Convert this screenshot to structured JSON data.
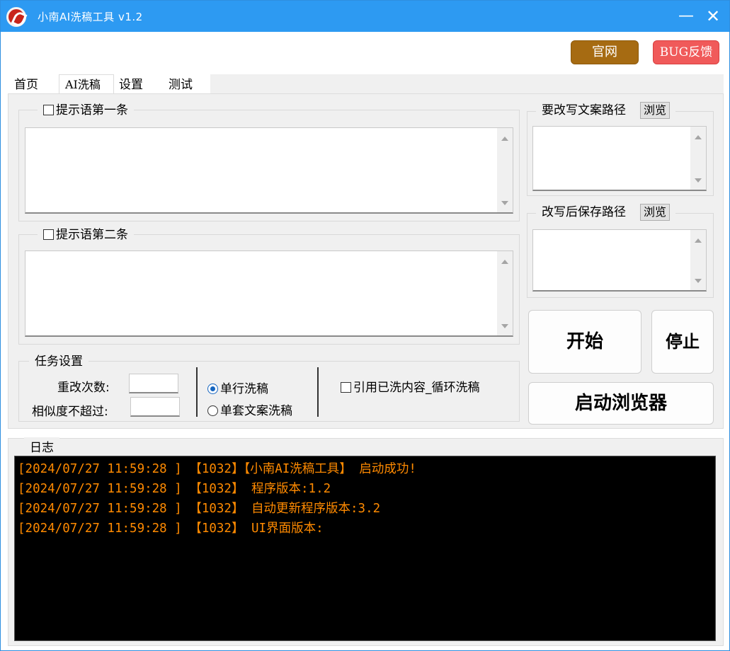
{
  "window": {
    "title": "小南AI洗稿工具  v1.2",
    "minimize_symbol": "—",
    "close_symbol": "✕"
  },
  "top_buttons": {
    "official_site": "官网",
    "bug_feedback": "BUG反馈"
  },
  "tabs": [
    {
      "label": "首页",
      "active": false
    },
    {
      "label": "AI洗稿",
      "active": true
    },
    {
      "label": "设置",
      "active": false
    },
    {
      "label": "测试",
      "active": false
    }
  ],
  "prompts": {
    "first_label": "提示语第一条",
    "first_value": "",
    "second_label": "提示语第二条",
    "second_value": ""
  },
  "paths": {
    "source_label": "要改写文案路径",
    "source_browse": "浏览",
    "source_value": "",
    "save_label": "改写后保存路径",
    "save_browse": "浏览",
    "save_value": ""
  },
  "task_settings": {
    "legend": "任务设置",
    "retry_label": "重改次数:",
    "retry_value": "",
    "similarity_label": "相似度不超过:",
    "similarity_value": "",
    "mode_single_line": "单行洗稿",
    "mode_single_set": "单套文案洗稿",
    "selected_mode": "single_line",
    "loop_label": "引用已洗内容_循环洗稿"
  },
  "actions": {
    "start": "开始",
    "stop": "停止",
    "launch_browser": "启动浏览器"
  },
  "log": {
    "title": "日志",
    "lines": [
      "[2024/07/27 11:59:28 ] 【1032】【小南AI洗稿工具】 启动成功!",
      "[2024/07/27 11:59:28 ] 【1032】 程序版本:1.2",
      "[2024/07/27 11:59:28 ] 【1032】 自动更新程序版本:3.2",
      "[2024/07/27 11:59:28 ] 【1032】 UI界面版本:"
    ],
    "text_color": "#ff8a00"
  },
  "colors": {
    "titlebar": "#2d9af2",
    "official_site_button": "#a66b12",
    "bug_button": "#f05a5a"
  }
}
